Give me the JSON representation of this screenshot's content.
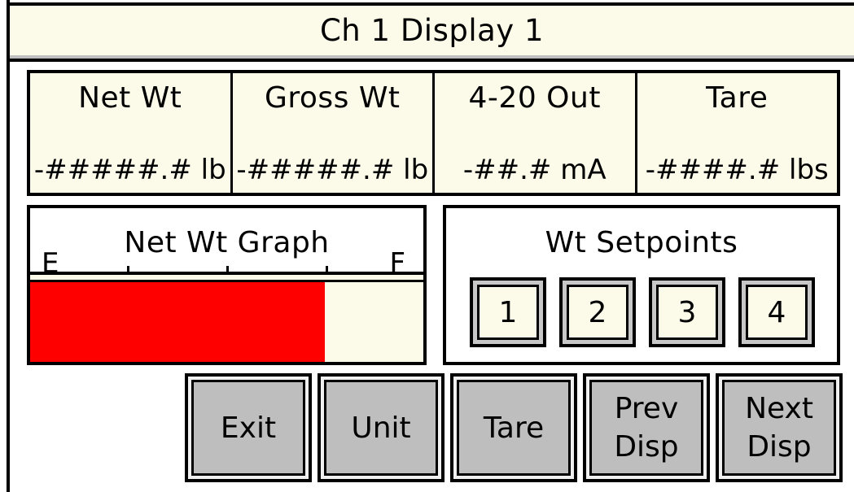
{
  "title": "Ch 1 Display 1",
  "readouts": [
    {
      "label": "Net Wt",
      "value": "-#####.# lb"
    },
    {
      "label": "Gross Wt",
      "value": "-#####.# lb"
    },
    {
      "label": "4-20 Out",
      "value": "-##.# mA"
    },
    {
      "label": "Tare",
      "value": "-####.# lbs"
    }
  ],
  "graph": {
    "title": "Net Wt Graph",
    "empty_label": "E",
    "full_label": "F",
    "fill_fraction": 0.75,
    "fill_color": "#ff0000"
  },
  "setpoints": {
    "title": "Wt Setpoints",
    "items": [
      "1",
      "2",
      "3",
      "4"
    ]
  },
  "buttons": {
    "exit": "Exit",
    "unit": "Unit",
    "tare": "Tare",
    "prev": "Prev\nDisp",
    "next": "Next\nDisp"
  },
  "colors": {
    "panel_bg": "#fcfae8",
    "button_face": "#bebebe",
    "accent": "#ff0000"
  }
}
